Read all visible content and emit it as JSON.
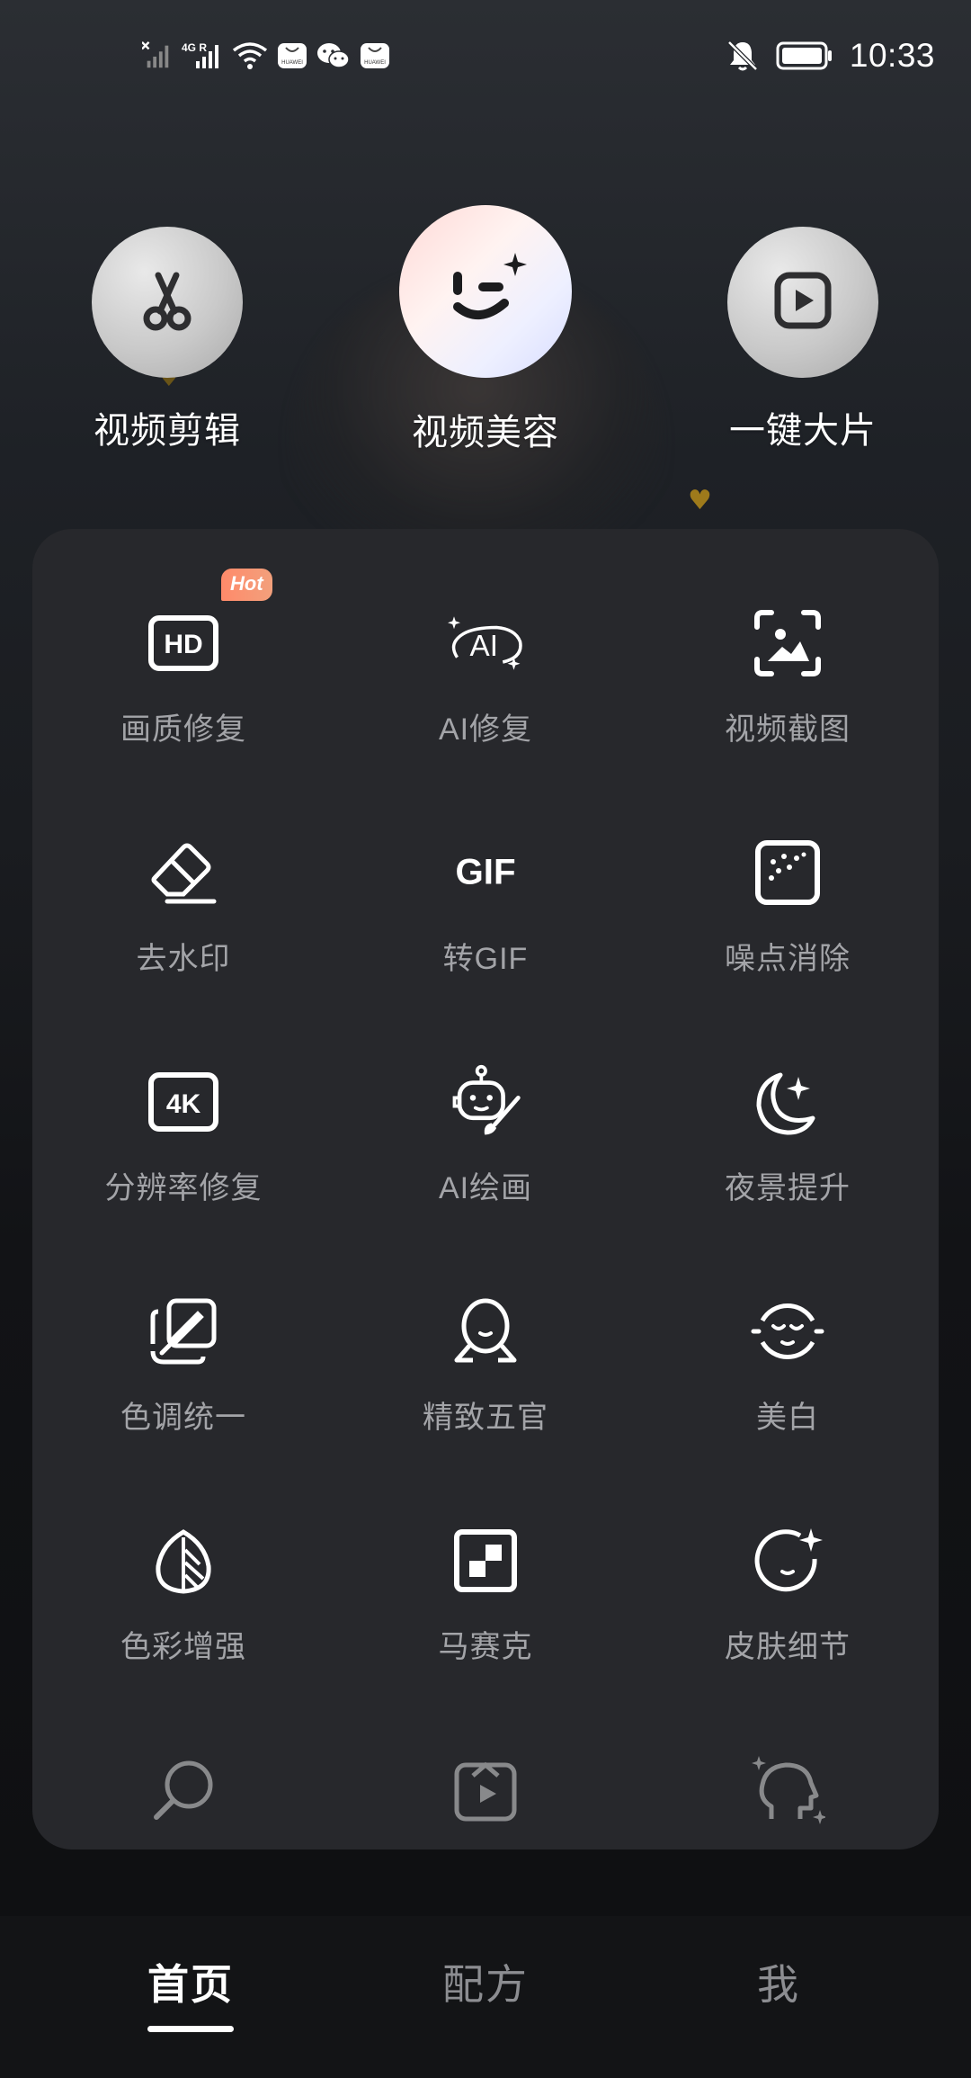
{
  "status_bar": {
    "time": "10:33",
    "network_label": "4G R",
    "app_badge_label": "HUAWEI",
    "icons": [
      "no-sim-signal-icon",
      "signal-icon",
      "wifi-icon",
      "huawei-app-icon",
      "wechat-icon",
      "huawei-app-icon",
      "bell-muted-icon",
      "battery-icon"
    ]
  },
  "top_features": [
    {
      "label": "视频剪辑",
      "icon": "scissors-icon",
      "active": false
    },
    {
      "label": "视频美容",
      "icon": "wink-face-icon",
      "active": true
    },
    {
      "label": "一键大片",
      "icon": "play-square-icon",
      "active": false
    }
  ],
  "tools": [
    {
      "label": "画质修复",
      "icon": "hd-icon",
      "badge": "Hot"
    },
    {
      "label": "AI修复",
      "icon": "ai-sparkle-icon"
    },
    {
      "label": "视频截图",
      "icon": "screenshot-icon"
    },
    {
      "label": "去水印",
      "icon": "eraser-icon"
    },
    {
      "label": "转GIF",
      "icon": "gif-icon",
      "icon_text": "GIF"
    },
    {
      "label": "噪点消除",
      "icon": "noise-icon"
    },
    {
      "label": "分辨率修复",
      "icon": "4k-icon",
      "icon_text": "4K"
    },
    {
      "label": "AI绘画",
      "icon": "robot-brush-icon"
    },
    {
      "label": "夜景提升",
      "icon": "moon-sparkle-icon"
    },
    {
      "label": "色调统一",
      "icon": "color-picker-icon"
    },
    {
      "label": "精致五官",
      "icon": "face-outline-icon"
    },
    {
      "label": "美白",
      "icon": "whitening-face-icon"
    },
    {
      "label": "色彩增强",
      "icon": "leaf-icon"
    },
    {
      "label": "马赛克",
      "icon": "mosaic-icon"
    },
    {
      "label": "皮肤细节",
      "icon": "face-sparkle-icon"
    }
  ],
  "partial_tools": [
    {
      "icon": "search-icon"
    },
    {
      "icon": "video-upscale-icon"
    },
    {
      "icon": "head-sparkle-icon"
    }
  ],
  "hd_icon_text": "HD",
  "ai_icon_text": "AI",
  "bottom_nav": [
    {
      "label": "首页",
      "active": true
    },
    {
      "label": "配方",
      "active": false
    },
    {
      "label": "我",
      "active": false
    }
  ],
  "colors": {
    "panel": "#27282c",
    "label_gray": "#a3a4a8",
    "hot_badge": "#ff8a6a",
    "nav_inactive": "#8c8d91"
  }
}
